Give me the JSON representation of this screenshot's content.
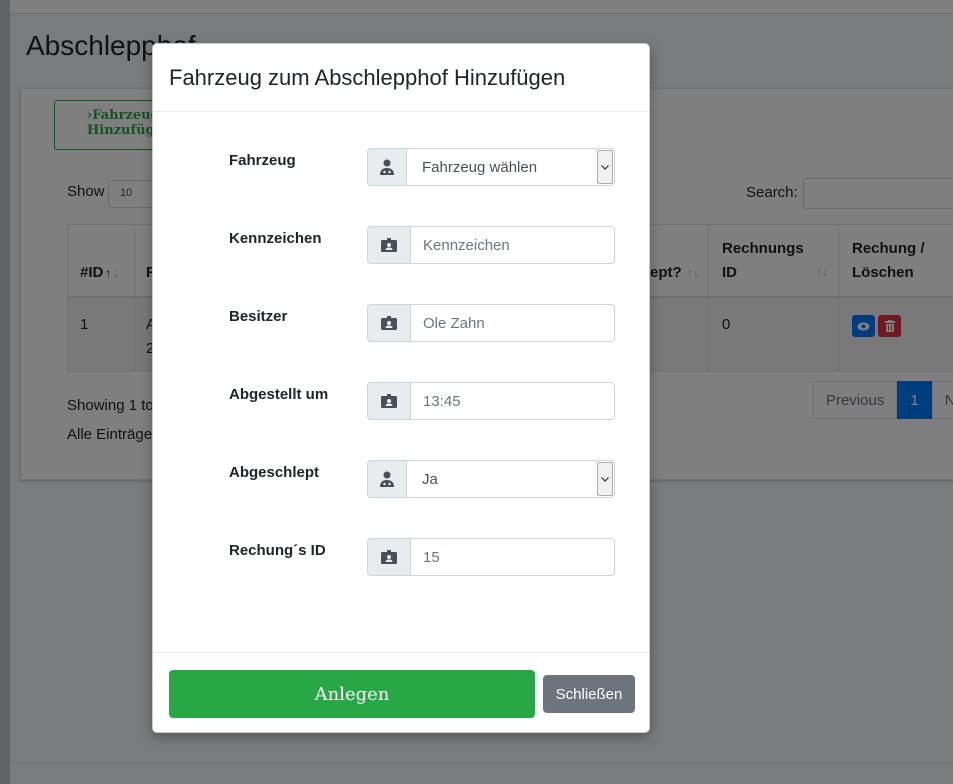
{
  "page": {
    "title": "Abschlepphof",
    "add_button_label": "›Fahrzeug Hinzufügen",
    "show_label": "Show",
    "show_value": "10",
    "search_label": "Search:",
    "table": {
      "headers": {
        "id": "#ID",
        "col2": "F",
        "abgeschleppt": "ept?",
        "rechnungs_id": "Rechnungs ID",
        "rechnung_loeschen": "Rechung / Löschen"
      },
      "row": {
        "id": "1",
        "col2_line1": "A",
        "col2_line2": "2",
        "rechnungs_id": "0"
      }
    },
    "showing_text": "Showing 1 to",
    "alle_text": "Alle Einträge",
    "pagination": {
      "previous": "Previous",
      "current": "1",
      "next": "N"
    }
  },
  "modal": {
    "title": "Fahrzeug zum Abschlepphof Hinzufügen",
    "fields": {
      "fahrzeug": {
        "label": "Fahrzeug",
        "value": "Fahrzeug wählen"
      },
      "kennzeichen": {
        "label": "Kennzeichen",
        "placeholder": "Kennzeichen"
      },
      "besitzer": {
        "label": "Besitzer",
        "placeholder": "Ole Zahn"
      },
      "abgestellt": {
        "label": "Abgestellt um",
        "placeholder": "13:45"
      },
      "abgeschlept": {
        "label": "Abgeschlept",
        "value": "Ja"
      },
      "rechnung_id": {
        "label": "Rechung´s ID",
        "placeholder": "15"
      }
    },
    "buttons": {
      "submit": "Anlegen",
      "close": "Schließen"
    }
  },
  "colors": {
    "success": "#28a745",
    "secondary": "#6c757d",
    "primary": "#007bff",
    "danger": "#dc3545"
  }
}
